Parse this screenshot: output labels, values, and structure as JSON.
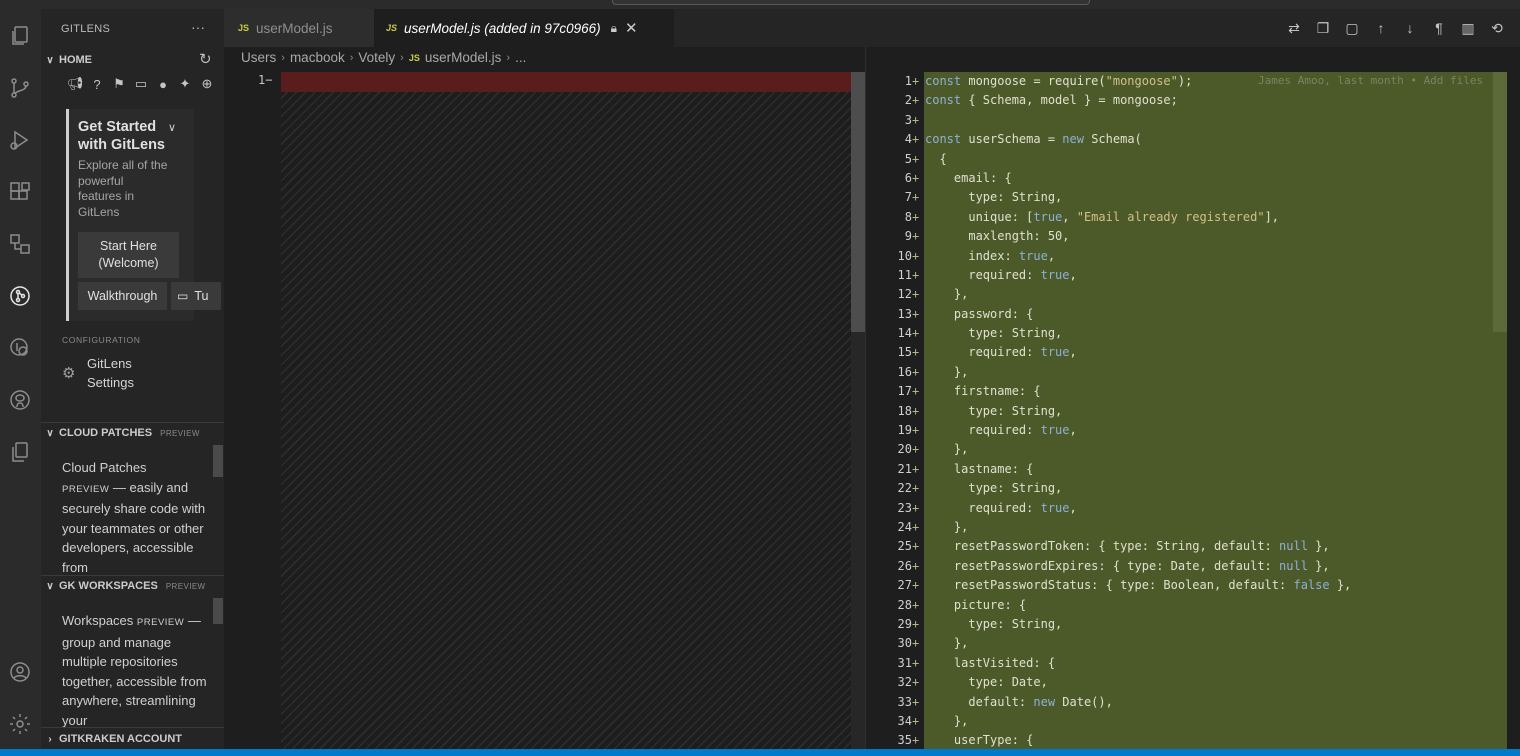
{
  "sidebar": {
    "title": "GITLENS",
    "more": "···",
    "home_section": "HOME",
    "get_started_title": "Get Started with GitLens",
    "get_started_desc": "Explore all of the powerful features in GitLens",
    "start_here": "Start Here (Welcome)",
    "walkthrough": "Walkthrough",
    "tu": "Tu",
    "configuration_label": "CONFIGURATION",
    "gitlens_settings": "GitLens Settings",
    "cloud_patches": {
      "header": "CLOUD PATCHES",
      "tag": "PREVIEW",
      "p1": "Cloud Patches",
      "p2": "PREVIEW",
      "p3": " — easily and securely share code with your teammates or other developers, accessible from"
    },
    "gk_workspaces": {
      "header": "GK WORKSPACES",
      "tag": "PREVIEW",
      "p1": "Workspaces ",
      "p2": "PREVIEW",
      "p3": " — group and manage multiple repositories together, accessible from anywhere, streamlining your"
    },
    "gitkraken_account": "GITKRAKEN ACCOUNT"
  },
  "tabs": [
    {
      "label": "userModel.js",
      "icon": "JS"
    },
    {
      "label": "userModel.js (added in 97c0966)",
      "icon": "JS"
    }
  ],
  "breadcrumb": [
    "Users",
    "macbook",
    "Votely",
    "userModel.js",
    "..."
  ],
  "left_pane": {
    "line": "1"
  },
  "right_pane": {
    "blame": "James Amoo, last month • Add files",
    "lines": [
      "const mongoose = require(\"mongoose\");",
      "const { Schema, model } = mongoose;",
      "",
      "const userSchema = new Schema(",
      "  {",
      "    email: {",
      "      type: String,",
      "      unique: [true, \"Email already registered\"],",
      "      maxlength: 50,",
      "      index: true,",
      "      required: true,",
      "    },",
      "    password: {",
      "      type: String,",
      "      required: true,",
      "    },",
      "    firstname: {",
      "      type: String,",
      "      required: true,",
      "    },",
      "    lastname: {",
      "      type: String,",
      "      required: true,",
      "    },",
      "    resetPasswordToken: { type: String, default: null },",
      "    resetPasswordExpires: { type: Date, default: null },",
      "    resetPasswordStatus: { type: Boolean, default: false },",
      "    picture: {",
      "      type: String,",
      "    },",
      "    lastVisited: {",
      "      type: Date,",
      "      default: new Date(),",
      "    },",
      "    userType: {"
    ]
  },
  "colors": {
    "accent": "#007acc",
    "added_bg": "#4b5a28",
    "removed_bg": "#5a1d1d",
    "js_icon": "#cbcb41"
  },
  "icons": {
    "activity": [
      "explorer-icon",
      "source-control-icon",
      "run-debug-icon",
      "extensions-icon",
      "remote-explorer-icon",
      "gitlens-icon",
      "gitlens-inspect-icon",
      "github-icon",
      "copy-icon",
      "account-icon",
      "settings-gear-icon"
    ],
    "toolbar": [
      "compare-icon",
      "open-file-icon",
      "open-changes-icon",
      "arrow-up-icon",
      "arrow-down-icon",
      "pilcrow-icon",
      "map-icon",
      "revert-icon",
      "more-icon"
    ]
  }
}
